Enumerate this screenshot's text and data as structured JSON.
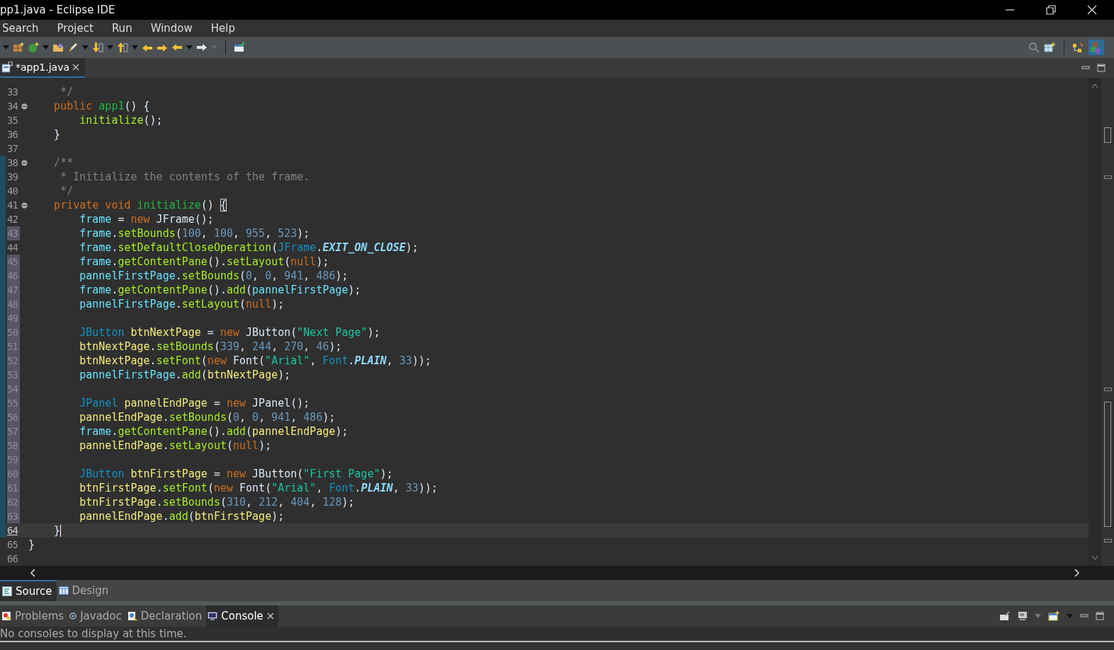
{
  "window": {
    "title": "pp1.java - Eclipse IDE"
  },
  "menu": [
    {
      "label": "Search"
    },
    {
      "label": "Project"
    },
    {
      "label": "Run"
    },
    {
      "label": "Window"
    },
    {
      "label": "Help"
    }
  ],
  "editor_tabs": [
    {
      "label": "*app1.java",
      "selected": true
    }
  ],
  "editor": {
    "lines": [
      {
        "n": "33",
        "fold": false,
        "changed": false,
        "scope": false,
        "current": false,
        "tokens": [
          {
            "kind": "com",
            "text": "     */"
          }
        ]
      },
      {
        "n": "34",
        "fold": true,
        "changed": false,
        "scope": false,
        "current": false,
        "tokens": [
          {
            "kind": "kw",
            "text": "    public"
          },
          {
            "kind": "decl",
            "text": " app1"
          },
          {
            "kind": "p",
            "text": "() {"
          }
        ]
      },
      {
        "n": "35",
        "fold": false,
        "changed": false,
        "scope": false,
        "current": false,
        "tokens": [
          {
            "kind": "call",
            "text": "        initialize"
          },
          {
            "kind": "p",
            "text": "();"
          }
        ]
      },
      {
        "n": "36",
        "fold": false,
        "changed": false,
        "scope": false,
        "current": false,
        "tokens": [
          {
            "kind": "p",
            "text": "    }"
          }
        ]
      },
      {
        "n": "37",
        "fold": false,
        "changed": false,
        "scope": false,
        "current": false
      },
      {
        "n": "38",
        "fold": true,
        "changed": false,
        "scope": true,
        "current": false,
        "tokens": [
          {
            "kind": "com",
            "text": "    /**"
          }
        ]
      },
      {
        "n": "39",
        "fold": false,
        "changed": false,
        "scope": true,
        "current": false,
        "tokens": [
          {
            "kind": "com",
            "text": "     * Initialize the contents of the frame."
          }
        ]
      },
      {
        "n": "40",
        "fold": false,
        "changed": false,
        "scope": true,
        "current": false,
        "tokens": [
          {
            "kind": "com",
            "text": "     */"
          }
        ]
      },
      {
        "n": "41",
        "fold": true,
        "changed": false,
        "scope": true,
        "current": false,
        "tokens": [
          {
            "kind": "kw",
            "text": "    private void"
          },
          {
            "kind": "decl",
            "text": " initialize"
          },
          {
            "kind": "p",
            "text": "() "
          },
          {
            "kind": "match",
            "text": "{"
          }
        ]
      },
      {
        "n": "42",
        "fold": false,
        "changed": false,
        "scope": true,
        "current": false,
        "tokens": [
          {
            "kind": "field",
            "text": "        frame"
          },
          {
            "kind": "p",
            "text": " = "
          },
          {
            "kind": "kw",
            "text": "new"
          },
          {
            "kind": "p",
            "text": " JFrame();"
          }
        ]
      },
      {
        "n": "43",
        "fold": false,
        "changed": true,
        "scope": true,
        "current": false,
        "tokens": [
          {
            "kind": "field",
            "text": "        frame"
          },
          {
            "kind": "p",
            "text": "."
          },
          {
            "kind": "call",
            "text": "setBounds"
          },
          {
            "kind": "p",
            "text": "("
          },
          {
            "kind": "num",
            "text": "100"
          },
          {
            "kind": "p",
            "text": ", "
          },
          {
            "kind": "num",
            "text": "100"
          },
          {
            "kind": "p",
            "text": ", "
          },
          {
            "kind": "num",
            "text": "955"
          },
          {
            "kind": "p",
            "text": ", "
          },
          {
            "kind": "num",
            "text": "523"
          },
          {
            "kind": "p",
            "text": ");"
          }
        ]
      },
      {
        "n": "44",
        "fold": false,
        "changed": false,
        "scope": true,
        "current": false,
        "tokens": [
          {
            "kind": "field",
            "text": "        frame"
          },
          {
            "kind": "p",
            "text": "."
          },
          {
            "kind": "call",
            "text": "setDefaultCloseOperation"
          },
          {
            "kind": "p",
            "text": "("
          },
          {
            "kind": "type",
            "text": "JFrame"
          },
          {
            "kind": "p",
            "text": "."
          },
          {
            "kind": "const",
            "text": "EXIT_ON_CLOSE"
          },
          {
            "kind": "p",
            "text": ");"
          }
        ]
      },
      {
        "n": "45",
        "fold": false,
        "changed": true,
        "scope": true,
        "current": false,
        "tokens": [
          {
            "kind": "field",
            "text": "        frame"
          },
          {
            "kind": "p",
            "text": "."
          },
          {
            "kind": "call",
            "text": "getContentPane"
          },
          {
            "kind": "p",
            "text": "()."
          },
          {
            "kind": "call",
            "text": "setLayout"
          },
          {
            "kind": "p",
            "text": "("
          },
          {
            "kind": "kw",
            "text": "null"
          },
          {
            "kind": "p",
            "text": ");"
          }
        ]
      },
      {
        "n": "46",
        "fold": false,
        "changed": true,
        "scope": true,
        "current": false,
        "tokens": [
          {
            "kind": "field",
            "text": "        pannelFirstPage"
          },
          {
            "kind": "p",
            "text": "."
          },
          {
            "kind": "call",
            "text": "setBounds"
          },
          {
            "kind": "p",
            "text": "("
          },
          {
            "kind": "num",
            "text": "0"
          },
          {
            "kind": "p",
            "text": ", "
          },
          {
            "kind": "num",
            "text": "0"
          },
          {
            "kind": "p",
            "text": ", "
          },
          {
            "kind": "num",
            "text": "941"
          },
          {
            "kind": "p",
            "text": ", "
          },
          {
            "kind": "num",
            "text": "486"
          },
          {
            "kind": "p",
            "text": ");"
          }
        ]
      },
      {
        "n": "47",
        "fold": false,
        "changed": true,
        "scope": true,
        "current": false,
        "tokens": [
          {
            "kind": "field",
            "text": "        frame"
          },
          {
            "kind": "p",
            "text": "."
          },
          {
            "kind": "call",
            "text": "getContentPane"
          },
          {
            "kind": "p",
            "text": "()."
          },
          {
            "kind": "call",
            "text": "add"
          },
          {
            "kind": "p",
            "text": "("
          },
          {
            "kind": "field",
            "text": "pannelFirstPage"
          },
          {
            "kind": "p",
            "text": ");"
          }
        ]
      },
      {
        "n": "48",
        "fold": false,
        "changed": true,
        "scope": true,
        "current": false,
        "tokens": [
          {
            "kind": "field",
            "text": "        pannelFirstPage"
          },
          {
            "kind": "p",
            "text": "."
          },
          {
            "kind": "call",
            "text": "setLayout"
          },
          {
            "kind": "p",
            "text": "("
          },
          {
            "kind": "kw",
            "text": "null"
          },
          {
            "kind": "p",
            "text": ");"
          }
        ]
      },
      {
        "n": "49",
        "fold": false,
        "changed": true,
        "scope": true,
        "current": false
      },
      {
        "n": "50",
        "fold": false,
        "changed": true,
        "scope": true,
        "current": false,
        "tokens": [
          {
            "kind": "type",
            "text": "        JButton"
          },
          {
            "kind": "local",
            "text": " btnNextPage"
          },
          {
            "kind": "p",
            "text": " = "
          },
          {
            "kind": "kw",
            "text": "new"
          },
          {
            "kind": "p",
            "text": " JButton("
          },
          {
            "kind": "str",
            "text": "\"Next Page\""
          },
          {
            "kind": "p",
            "text": ");"
          }
        ]
      },
      {
        "n": "51",
        "fold": false,
        "changed": true,
        "scope": true,
        "current": false,
        "tokens": [
          {
            "kind": "local",
            "text": "        btnNextPage"
          },
          {
            "kind": "p",
            "text": "."
          },
          {
            "kind": "call",
            "text": "setBounds"
          },
          {
            "kind": "p",
            "text": "("
          },
          {
            "kind": "num",
            "text": "339"
          },
          {
            "kind": "p",
            "text": ", "
          },
          {
            "kind": "num",
            "text": "244"
          },
          {
            "kind": "p",
            "text": ", "
          },
          {
            "kind": "num",
            "text": "270"
          },
          {
            "kind": "p",
            "text": ", "
          },
          {
            "kind": "num",
            "text": "46"
          },
          {
            "kind": "p",
            "text": ");"
          }
        ]
      },
      {
        "n": "52",
        "fold": false,
        "changed": true,
        "scope": true,
        "current": false,
        "tokens": [
          {
            "kind": "local",
            "text": "        btnNextPage"
          },
          {
            "kind": "p",
            "text": "."
          },
          {
            "kind": "call",
            "text": "setFont"
          },
          {
            "kind": "p",
            "text": "("
          },
          {
            "kind": "kw",
            "text": "new"
          },
          {
            "kind": "p",
            "text": " Font("
          },
          {
            "kind": "str",
            "text": "\"Arial\""
          },
          {
            "kind": "p",
            "text": ", "
          },
          {
            "kind": "type",
            "text": "Font"
          },
          {
            "kind": "p",
            "text": "."
          },
          {
            "kind": "const",
            "text": "PLAIN"
          },
          {
            "kind": "p",
            "text": ", "
          },
          {
            "kind": "num",
            "text": "33"
          },
          {
            "kind": "p",
            "text": "));"
          }
        ]
      },
      {
        "n": "53",
        "fold": false,
        "changed": true,
        "scope": true,
        "current": false,
        "tokens": [
          {
            "kind": "field",
            "text": "        pannelFirstPage"
          },
          {
            "kind": "p",
            "text": "."
          },
          {
            "kind": "call",
            "text": "add"
          },
          {
            "kind": "p",
            "text": "("
          },
          {
            "kind": "local",
            "text": "btnNextPage"
          },
          {
            "kind": "p",
            "text": ");"
          }
        ]
      },
      {
        "n": "54",
        "fold": false,
        "changed": true,
        "scope": true,
        "current": false
      },
      {
        "n": "55",
        "fold": false,
        "changed": true,
        "scope": true,
        "current": false,
        "tokens": [
          {
            "kind": "type",
            "text": "        JPanel"
          },
          {
            "kind": "local",
            "text": " pannelEndPage"
          },
          {
            "kind": "p",
            "text": " = "
          },
          {
            "kind": "kw",
            "text": "new"
          },
          {
            "kind": "p",
            "text": " JPanel();"
          }
        ]
      },
      {
        "n": "56",
        "fold": false,
        "changed": true,
        "scope": true,
        "current": false,
        "tokens": [
          {
            "kind": "local",
            "text": "        pannelEndPage"
          },
          {
            "kind": "p",
            "text": "."
          },
          {
            "kind": "call",
            "text": "setBounds"
          },
          {
            "kind": "p",
            "text": "("
          },
          {
            "kind": "num",
            "text": "0"
          },
          {
            "kind": "p",
            "text": ", "
          },
          {
            "kind": "num",
            "text": "0"
          },
          {
            "kind": "p",
            "text": ", "
          },
          {
            "kind": "num",
            "text": "941"
          },
          {
            "kind": "p",
            "text": ", "
          },
          {
            "kind": "num",
            "text": "486"
          },
          {
            "kind": "p",
            "text": ");"
          }
        ]
      },
      {
        "n": "57",
        "fold": false,
        "changed": true,
        "scope": true,
        "current": false,
        "tokens": [
          {
            "kind": "field",
            "text": "        frame"
          },
          {
            "kind": "p",
            "text": "."
          },
          {
            "kind": "call",
            "text": "getContentPane"
          },
          {
            "kind": "p",
            "text": "()."
          },
          {
            "kind": "call",
            "text": "add"
          },
          {
            "kind": "p",
            "text": "("
          },
          {
            "kind": "local",
            "text": "pannelEndPage"
          },
          {
            "kind": "p",
            "text": ");"
          }
        ]
      },
      {
        "n": "58",
        "fold": false,
        "changed": true,
        "scope": true,
        "current": false,
        "tokens": [
          {
            "kind": "local",
            "text": "        pannelEndPage"
          },
          {
            "kind": "p",
            "text": "."
          },
          {
            "kind": "call",
            "text": "setLayout"
          },
          {
            "kind": "p",
            "text": "("
          },
          {
            "kind": "kw",
            "text": "null"
          },
          {
            "kind": "p",
            "text": ");"
          }
        ]
      },
      {
        "n": "59",
        "fold": false,
        "changed": true,
        "scope": true,
        "current": false
      },
      {
        "n": "60",
        "fold": false,
        "changed": true,
        "scope": true,
        "current": false,
        "tokens": [
          {
            "kind": "type",
            "text": "        JButton"
          },
          {
            "kind": "local",
            "text": " btnFirstPage"
          },
          {
            "kind": "p",
            "text": " = "
          },
          {
            "kind": "kw",
            "text": "new"
          },
          {
            "kind": "p",
            "text": " JButton("
          },
          {
            "kind": "str",
            "text": "\"First Page\""
          },
          {
            "kind": "p",
            "text": ");"
          }
        ]
      },
      {
        "n": "61",
        "fold": false,
        "changed": true,
        "scope": true,
        "current": false,
        "tokens": [
          {
            "kind": "local",
            "text": "        btnFirstPage"
          },
          {
            "kind": "p",
            "text": "."
          },
          {
            "kind": "call",
            "text": "setFont"
          },
          {
            "kind": "p",
            "text": "("
          },
          {
            "kind": "kw",
            "text": "new"
          },
          {
            "kind": "p",
            "text": " Font("
          },
          {
            "kind": "str",
            "text": "\"Arial\""
          },
          {
            "kind": "p",
            "text": ", "
          },
          {
            "kind": "type",
            "text": "Font"
          },
          {
            "kind": "p",
            "text": "."
          },
          {
            "kind": "const",
            "text": "PLAIN"
          },
          {
            "kind": "p",
            "text": ", "
          },
          {
            "kind": "num",
            "text": "33"
          },
          {
            "kind": "p",
            "text": "));"
          }
        ]
      },
      {
        "n": "62",
        "fold": false,
        "changed": true,
        "scope": true,
        "current": false,
        "tokens": [
          {
            "kind": "local",
            "text": "        btnFirstPage"
          },
          {
            "kind": "p",
            "text": "."
          },
          {
            "kind": "call",
            "text": "setBounds"
          },
          {
            "kind": "p",
            "text": "("
          },
          {
            "kind": "num",
            "text": "310"
          },
          {
            "kind": "p",
            "text": ", "
          },
          {
            "kind": "num",
            "text": "212"
          },
          {
            "kind": "p",
            "text": ", "
          },
          {
            "kind": "num",
            "text": "404"
          },
          {
            "kind": "p",
            "text": ", "
          },
          {
            "kind": "num",
            "text": "128"
          },
          {
            "kind": "p",
            "text": ");"
          }
        ]
      },
      {
        "n": "63",
        "fold": false,
        "changed": true,
        "scope": true,
        "current": false,
        "tokens": [
          {
            "kind": "local",
            "text": "        pannelEndPage"
          },
          {
            "kind": "p",
            "text": "."
          },
          {
            "kind": "call",
            "text": "add"
          },
          {
            "kind": "p",
            "text": "("
          },
          {
            "kind": "local",
            "text": "btnFirstPage"
          },
          {
            "kind": "p",
            "text": ");"
          }
        ]
      },
      {
        "n": "64",
        "fold": false,
        "changed": false,
        "scope": true,
        "current": true,
        "tokens": [
          {
            "kind": "p",
            "text": "    }"
          }
        ]
      },
      {
        "n": "65",
        "fold": false,
        "changed": false,
        "scope": false,
        "current": false,
        "tokens": [
          {
            "kind": "p",
            "text": "}"
          }
        ]
      },
      {
        "n": "66",
        "fold": false,
        "changed": false,
        "scope": false,
        "current": false
      }
    ]
  },
  "editor_mode_tabs": [
    {
      "label": "Source",
      "selected": true
    },
    {
      "label": "Design",
      "selected": false
    }
  ],
  "view_tabs": [
    {
      "label": "Problems",
      "selected": false,
      "closable": false
    },
    {
      "label": "Javadoc",
      "selected": false,
      "closable": false
    },
    {
      "label": "Declaration",
      "selected": false,
      "closable": false
    },
    {
      "label": "Console",
      "selected": true,
      "closable": true
    }
  ],
  "console": {
    "message": "No consoles to display at this time."
  }
}
